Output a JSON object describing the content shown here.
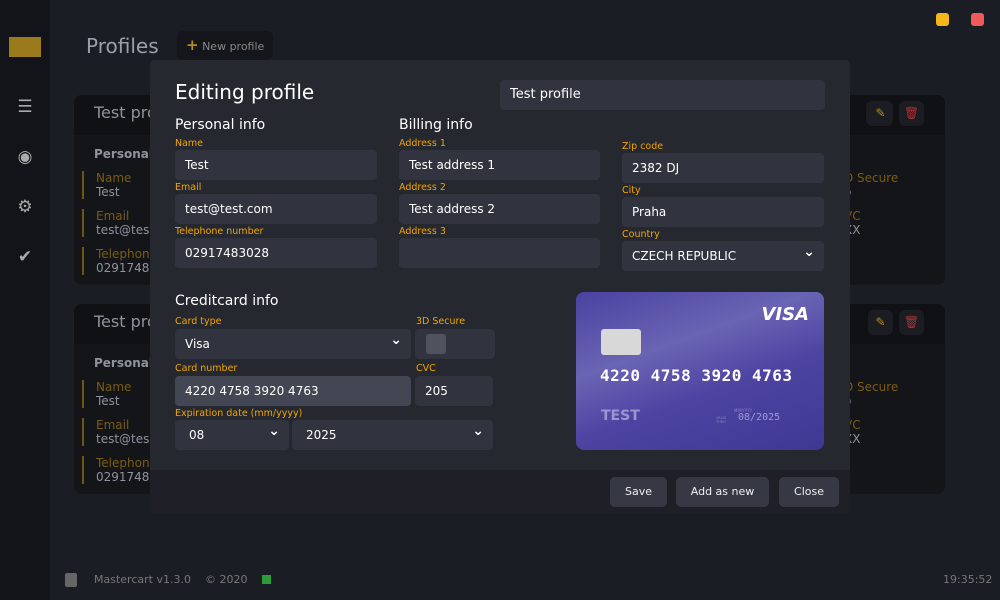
{
  "app": {
    "title": "Profiles",
    "new_profile": "New profile",
    "version": "Mastercart v1.3.0",
    "copyright": "© 2020",
    "time": "19:35:52",
    "accent": "#f0a500"
  },
  "sidebar": {
    "items": [
      {
        "icon": "server-icon"
      },
      {
        "icon": "user-circle-icon"
      },
      {
        "icon": "gear-icon"
      },
      {
        "icon": "double-check-icon"
      }
    ]
  },
  "background_cards": [
    {
      "title": "Test pro",
      "section": "Personal i",
      "name_label": "Name",
      "name": "Test",
      "email_label": "Email",
      "email": "test@tes",
      "phone_label": "Telephone",
      "phone": "02917483",
      "secure_label": "D Secure",
      "secure": "o",
      "cvc_label": "VC",
      "cvc": "XX"
    },
    {
      "title": "Test pro",
      "section": "Personal i",
      "name_label": "Name",
      "name": "Test",
      "email_label": "Email",
      "email": "test@tes",
      "phone_label": "Telephone",
      "phone": "02917483",
      "secure_label": "D Secure",
      "secure": "o",
      "cvc_label": "VC",
      "cvc": "XX"
    }
  ],
  "modal": {
    "title": "Editing profile",
    "profile_name": "Test profile",
    "personal": {
      "heading": "Personal info",
      "name_label": "Name",
      "name": "Test",
      "email_label": "Email",
      "email": "test@test.com",
      "phone_label": "Telephone number",
      "phone": "02917483028"
    },
    "billing": {
      "heading": "Billing info",
      "address1_label": "Address 1",
      "address1": "Test address 1",
      "address2_label": "Address 2",
      "address2": "Test address 2",
      "address3_label": "Address 3",
      "address3": "",
      "zip_label": "Zip code",
      "zip": "2382 DJ",
      "city_label": "City",
      "city": "Praha",
      "country_label": "Country",
      "country": "CZECH REPUBLIC"
    },
    "card": {
      "heading": "Creditcard info",
      "type_label": "Card type",
      "type": "Visa",
      "secure_label": "3D Secure",
      "secure_checked": false,
      "number_label": "Card number",
      "number": "4220 4758 3920 4763",
      "cvc_label": "CVC",
      "cvc": "205",
      "exp_label": "Expiration date (mm/yyyy)",
      "exp_month": "08",
      "exp_year": "2025"
    },
    "preview": {
      "brand": "VISA",
      "number": "4220 4758 3920 4763",
      "holder": "TEST",
      "expiry": "08/2025",
      "expiry_hint": "MM/YYYY",
      "valid_thru": "VALID THRU",
      "color": "#4a42a0"
    },
    "buttons": {
      "save": "Save",
      "add_new": "Add as new",
      "close": "Close"
    }
  }
}
